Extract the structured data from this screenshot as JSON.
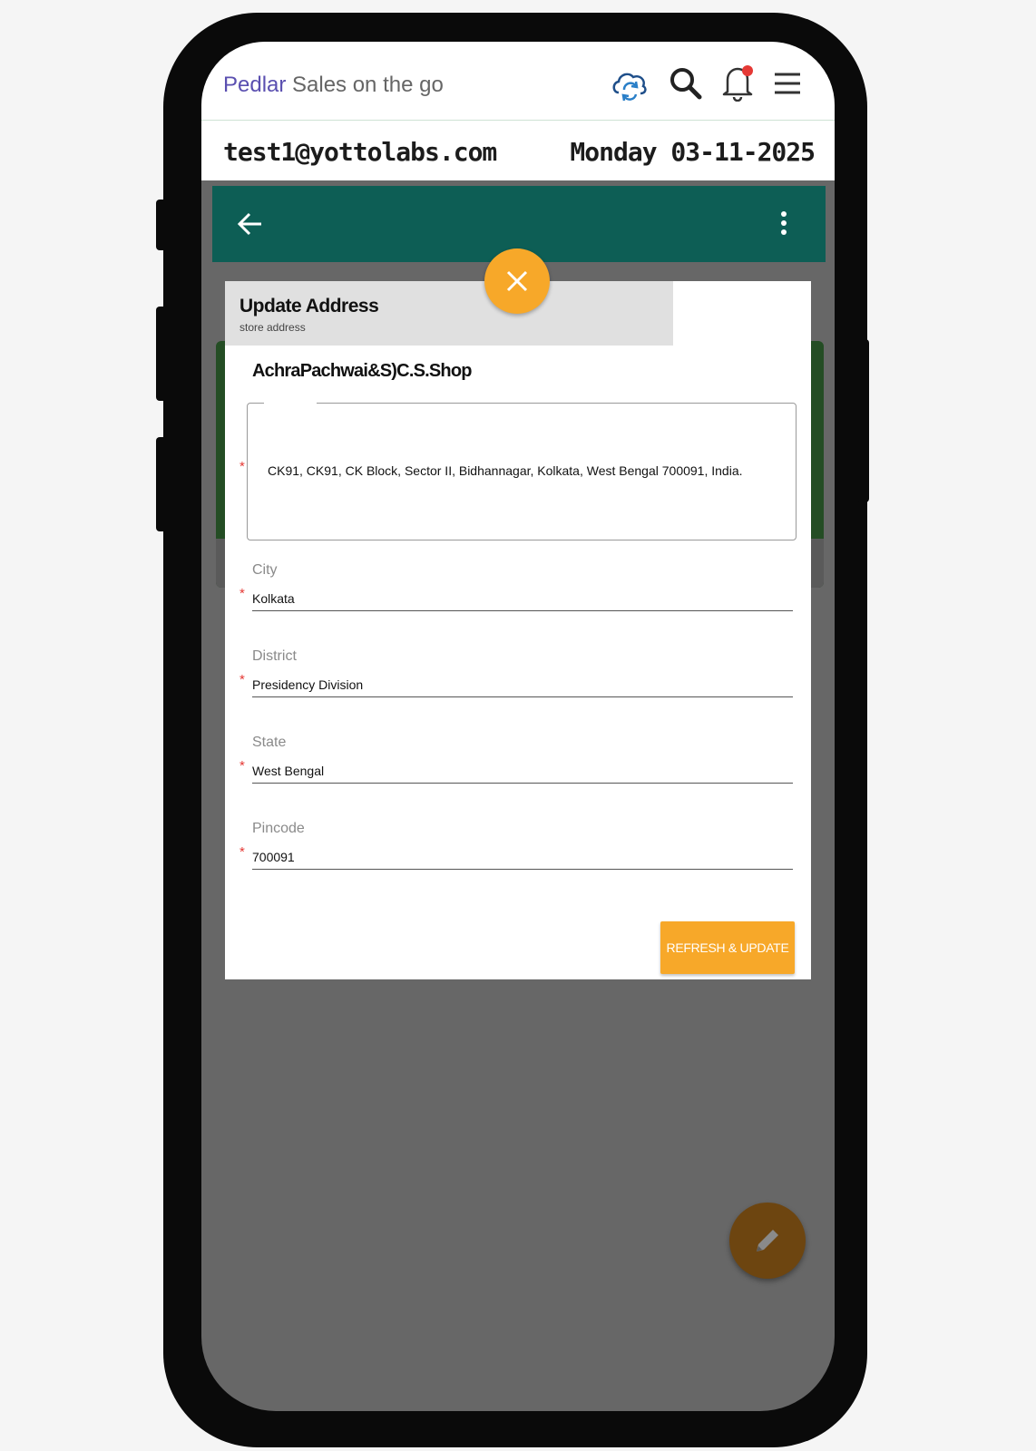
{
  "header": {
    "brand": "Pedlar",
    "tagline": "Sales on the go",
    "icons": [
      "cloud-sync-icon",
      "search-icon",
      "bell-icon",
      "menu-icon"
    ],
    "notification_dot_color": "#e53935"
  },
  "info": {
    "email": "test1@yottolabs.com",
    "date": "Monday 03-11-2025"
  },
  "appbar": {
    "color": "#0d5e55",
    "icons": [
      "back-arrow-icon",
      "more-vert-icon"
    ]
  },
  "dialog": {
    "title": "Update Address",
    "subtitle": "store address",
    "shop_name": "AchraPachwai&S)C.S.Shop",
    "address": "CK91, CK91, CK Block, Sector II, Bidhannagar, Kolkata, West Bengal 700091, India.",
    "fields": [
      {
        "label": "City",
        "value": "Kolkata"
      },
      {
        "label": "District",
        "value": "Presidency Division"
      },
      {
        "label": "State",
        "value": "West Bengal"
      },
      {
        "label": "Pincode",
        "value": "700091"
      }
    ],
    "required_mark": "*",
    "action_label": "REFRESH & UPDATE",
    "accent_color": "#f7a829"
  },
  "fab": {
    "icon": "pencil-icon",
    "color": "#6d4510"
  }
}
